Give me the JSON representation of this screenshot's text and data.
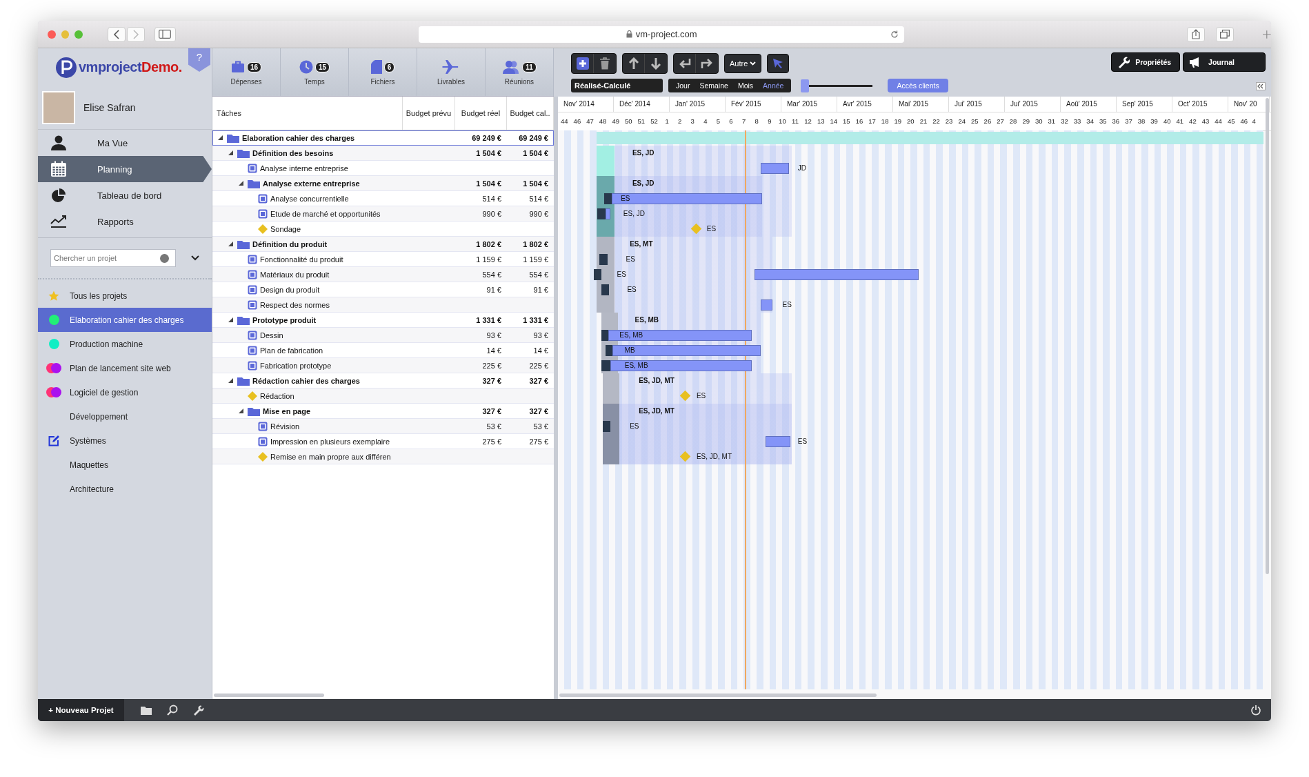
{
  "browser": {
    "url": "vm-project.com"
  },
  "logo": {
    "name": "vmproject",
    "suffix": "Demo.",
    "help": "?"
  },
  "user": {
    "name": "Elise Safran"
  },
  "nav": [
    {
      "label": "Ma Vue",
      "selected": false
    },
    {
      "label": "Planning",
      "selected": true
    },
    {
      "label": "Tableau de bord",
      "selected": false
    },
    {
      "label": "Rapports",
      "selected": false
    }
  ],
  "search": {
    "placeholder": "Chercher un projet"
  },
  "projects": [
    {
      "label": "Tous les projets",
      "kind": "star",
      "selected": false
    },
    {
      "label": "Elaboration cahier des charges",
      "kind": "dot",
      "color": "#22ee77",
      "selected": true
    },
    {
      "label": "Production machine",
      "kind": "dot",
      "color": "#11eec4",
      "selected": false
    },
    {
      "label": "Plan de lancement site web",
      "kind": "pair",
      "dots": [
        {
          "color": "#ff3377"
        },
        {
          "color": "#aa11ee"
        }
      ],
      "selected": false
    },
    {
      "label": "Logiciel de gestion",
      "kind": "pair",
      "dots": [
        {
          "color": "#ff3377"
        },
        {
          "color": "#aa11ee"
        }
      ],
      "selected": false
    },
    {
      "label": "Développement",
      "kind": "plain",
      "selected": false
    },
    {
      "label": "Systèmes",
      "kind": "edit",
      "selected": false
    },
    {
      "label": "Maquettes",
      "kind": "plain",
      "selected": false
    },
    {
      "label": "Architecture",
      "kind": "plain",
      "selected": false
    }
  ],
  "tabs": [
    {
      "label": "Dépenses",
      "count": "16"
    },
    {
      "label": "Temps",
      "count": "15"
    },
    {
      "label": "Fichiers",
      "count": "6"
    },
    {
      "label": "Livrables"
    },
    {
      "label": "Réunions",
      "count": "11"
    }
  ],
  "toolbar": {
    "menu": "Autre",
    "mode": "Réalisé-Calculé",
    "scales": [
      {
        "label": "Jour",
        "selected": false
      },
      {
        "label": "Semaine",
        "selected": false
      },
      {
        "label": "Mois",
        "selected": false
      },
      {
        "label": "Année",
        "selected": true
      }
    ],
    "zoom": {
      "level": 0
    },
    "clients": "Accès clients",
    "properties": "Propriétés",
    "journal": "Journal"
  },
  "table": {
    "columns": [
      "Tâches",
      "Budget prévu",
      "Budget réel",
      "Budget cal.."
    ]
  },
  "tasks": [
    {
      "name": "Elaboration cahier des charges",
      "kind": "folder",
      "expanded": true,
      "selected": true,
      "budget_reel": "69 249 €",
      "budget_cal": "69 249 €",
      "color": "#b2ece8",
      "children": [
        {
          "name": "Définition des besoins",
          "kind": "folder",
          "expanded": true,
          "selected": false,
          "budget_reel": "1 504 €",
          "budget_cal": "1 504 €",
          "color": "#a2efe3",
          "assignees": "ES, JD",
          "children": [
            {
              "name": "Analyse interne entreprise",
              "kind": "task",
              "selected": false,
              "assignees": "JD"
            },
            {
              "name": "Analyse externe entreprise",
              "kind": "folder",
              "expanded": true,
              "selected": false,
              "budget_reel": "1 504 €",
              "budget_cal": "1 504 €",
              "color": "#6aa9ab",
              "assignees": "ES, JD",
              "children": [
                {
                  "name": "Analyse concurrentielle",
                  "kind": "task",
                  "selected": false,
                  "budget_reel": "514 €",
                  "budget_cal": "514 €",
                  "assignees": "ES"
                },
                {
                  "name": "Etude de marché et opportunités",
                  "kind": "task",
                  "selected": false,
                  "budget_reel": "990 €",
                  "budget_cal": "990 €",
                  "assignees": "ES, JD"
                },
                {
                  "name": "Sondage",
                  "kind": "milestone",
                  "selected": false,
                  "assignees": "ES"
                }
              ]
            }
          ]
        },
        {
          "name": "Définition du produit",
          "kind": "folder",
          "expanded": true,
          "selected": false,
          "budget_reel": "1 802 €",
          "budget_cal": "1 802 €",
          "color": "#b2b6c2",
          "assignees": "ES, MT",
          "children": [
            {
              "name": "Fonctionnalité du produit",
              "kind": "task",
              "selected": false,
              "budget_reel": "1 159 €",
              "budget_cal": "1 159 €",
              "assignees": "ES"
            },
            {
              "name": "Matériaux du produit",
              "kind": "task",
              "selected": false,
              "budget_reel": "554 €",
              "budget_cal": "554 €",
              "assignees": "ES"
            },
            {
              "name": "Design du produit",
              "kind": "task",
              "selected": false,
              "budget_reel": "91 €",
              "budget_cal": "91 €",
              "assignees": "ES"
            },
            {
              "name": "Respect des normes",
              "kind": "task",
              "selected": false,
              "assignees": "ES"
            }
          ]
        },
        {
          "name": "Prototype produit",
          "kind": "folder",
          "expanded": true,
          "selected": false,
          "budget_reel": "1 331 €",
          "budget_cal": "1 331 €",
          "color": "#b4b8c4",
          "assignees": "ES, MB",
          "children": [
            {
              "name": "Dessin",
              "kind": "task",
              "selected": false,
              "budget_reel": "93 €",
              "budget_cal": "93 €",
              "assignees": "ES, MB"
            },
            {
              "name": "Plan de fabrication",
              "kind": "task",
              "selected": false,
              "budget_reel": "14 €",
              "budget_cal": "14 €",
              "assignees": "MB"
            },
            {
              "name": "Fabrication prototype",
              "kind": "task",
              "selected": false,
              "budget_reel": "225 €",
              "budget_cal": "225 €",
              "assignees": "ES, MB"
            }
          ]
        },
        {
          "name": "Rédaction cahier des charges",
          "kind": "folder",
          "expanded": true,
          "selected": false,
          "budget_reel": "327 €",
          "budget_cal": "327 €",
          "color": "#b4b8c4",
          "assignees": "ES, JD, MT",
          "children": [
            {
              "name": "Rédaction",
              "kind": "milestone",
              "selected": false,
              "assignees": "ES"
            },
            {
              "name": "Mise en page",
              "kind": "folder",
              "expanded": true,
              "selected": false,
              "budget_reel": "327 €",
              "budget_cal": "327 €",
              "color": "#8890a5",
              "assignees": "ES, JD, MT",
              "children": [
                {
                  "name": "Révision",
                  "kind": "task",
                  "selected": false,
                  "budget_reel": "53 €",
                  "budget_cal": "53 €",
                  "assignees": "ES"
                },
                {
                  "name": "Impression en plusieurs exemplaire",
                  "kind": "task",
                  "selected": false,
                  "budget_reel": "275 €",
                  "budget_cal": "275 €",
                  "assignees": "ES"
                },
                {
                  "name": "Remise en main propre aux différen",
                  "kind": "milestone",
                  "selected": false,
                  "assignees": "ES, JD, MT"
                }
              ]
            }
          ]
        }
      ]
    }
  ],
  "timeline": {
    "months": [
      "Nov' 2014",
      "Déc' 2014",
      "Jan' 2015",
      "Fév' 2015",
      "Mar' 2015",
      "Avr' 2015",
      "Mai' 2015",
      "Jui' 2015",
      "Jui' 2015",
      "Aoû' 2015",
      "Sep' 2015",
      "Oct' 2015",
      "Nov' 20"
    ],
    "weeks": [
      "44",
      "46",
      "47",
      "48",
      "49",
      "50",
      "51",
      "52",
      "1",
      "2",
      "3",
      "4",
      "5",
      "6",
      "7",
      "8",
      "9",
      "10",
      "11",
      "12",
      "13",
      "14",
      "15",
      "16",
      "17",
      "18",
      "19",
      "20",
      "21",
      "22",
      "23",
      "24",
      "25",
      "26",
      "27",
      "28",
      "29",
      "30",
      "31",
      "32",
      "33",
      "34",
      "35",
      "36",
      "37",
      "38",
      "39",
      "40",
      "41",
      "42",
      "43",
      "44",
      "45",
      "46",
      "4"
    ]
  },
  "footer": {
    "new_project": "+ Nouveau Projet"
  }
}
